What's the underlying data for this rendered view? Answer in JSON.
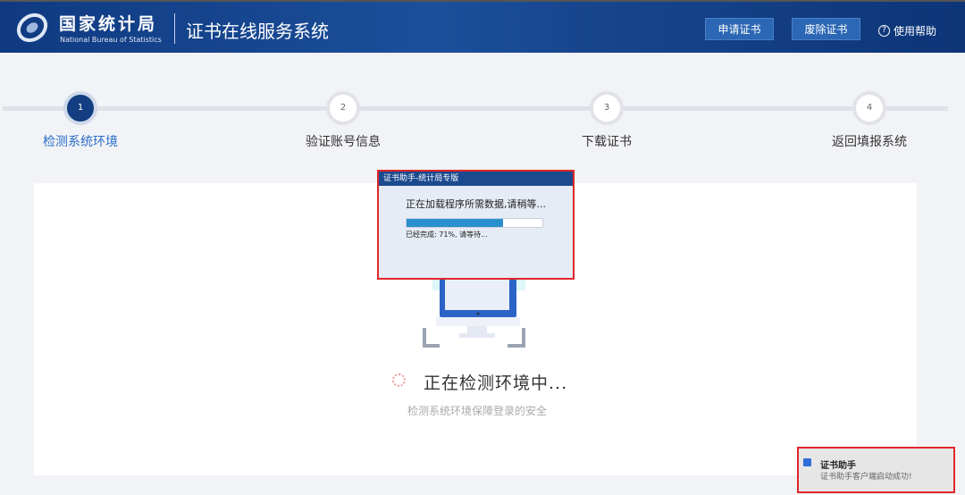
{
  "header": {
    "org_name": "国家统计局",
    "org_name_en": "National Bureau of Statistics",
    "system_title": "证书在线服务系统",
    "apply_button": "申请证书",
    "revoke_button": "废除证书",
    "help_label": "使用帮助",
    "help_icon": "?"
  },
  "steps": [
    {
      "number": "1",
      "label": "检测系统环境",
      "active": true
    },
    {
      "number": "2",
      "label": "验证账号信息",
      "active": false
    },
    {
      "number": "3",
      "label": "下载证书",
      "active": false
    },
    {
      "number": "4",
      "label": "返回填报系统",
      "active": false
    }
  ],
  "dialog": {
    "title": "证书助手-统计局专版",
    "message": "正在加载程序所需数据,请稍等...",
    "progress_percent": 71,
    "progress_text": "已经完成: 71%, 请等待..."
  },
  "status": {
    "title": "正在检测环境中...",
    "subtitle": "检测系统环境保障登录的安全"
  },
  "toast": {
    "title": "证书助手",
    "message": "证书助手客户端启动成功!"
  },
  "colors": {
    "header": "#123f85",
    "accent": "#2a6dc9",
    "progress": "#2a8fcd",
    "highlight": "#e0262a"
  }
}
